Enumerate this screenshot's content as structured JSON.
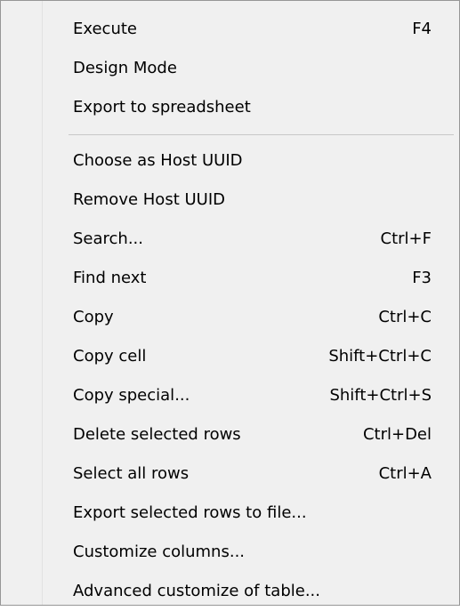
{
  "menu": {
    "items": [
      {
        "label": "Execute",
        "shortcut": "F4"
      },
      {
        "label": "Design Mode",
        "shortcut": ""
      },
      {
        "label": "Export to spreadsheet",
        "shortcut": ""
      },
      {
        "label": "Choose as Host UUID",
        "shortcut": ""
      },
      {
        "label": "Remove Host UUID",
        "shortcut": ""
      },
      {
        "label": "Search...",
        "shortcut": "Ctrl+F"
      },
      {
        "label": "Find next",
        "shortcut": "F3"
      },
      {
        "label": "Copy",
        "shortcut": "Ctrl+C"
      },
      {
        "label": "Copy cell",
        "shortcut": "Shift+Ctrl+C"
      },
      {
        "label": "Copy special...",
        "shortcut": "Shift+Ctrl+S"
      },
      {
        "label": "Delete selected rows",
        "shortcut": "Ctrl+Del"
      },
      {
        "label": "Select all rows",
        "shortcut": "Ctrl+A"
      },
      {
        "label": "Export selected rows to file...",
        "shortcut": ""
      },
      {
        "label": "Customize columns...",
        "shortcut": ""
      },
      {
        "label": "Advanced customize of table...",
        "shortcut": ""
      }
    ]
  }
}
